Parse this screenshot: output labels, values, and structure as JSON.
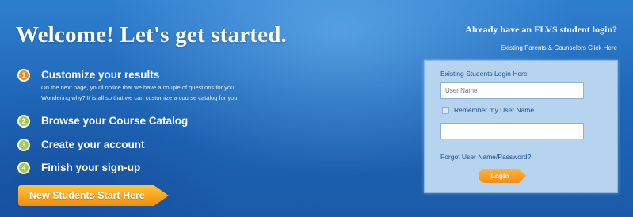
{
  "welcome": {
    "title": "Welcome! Let's get started."
  },
  "steps": [
    {
      "number": "1",
      "title": "Customize your results",
      "desc_line1": "On the next page, you'll notice that we have a couple of questions for you.",
      "desc_line2": "Wondering why? It is all so that we can customize a course catalog for you!",
      "color": "#f08a1a"
    },
    {
      "number": "2",
      "title": "Browse your Course Catalog",
      "color": "#9fcb4a"
    },
    {
      "number": "3",
      "title": "Create your account",
      "color": "#9fcb4a"
    },
    {
      "number": "4",
      "title": "Finish your sign-up",
      "color": "#9fcb4a"
    }
  ],
  "new_students_button": "New Students Start Here",
  "login": {
    "heading": "Already have an FLVS student login?",
    "parents_link": "Existing Parents & Counselors Click Here",
    "panel_title": "Existing Students Login Here",
    "username_placeholder": "User Name",
    "remember_label": "Remember my User Name",
    "password_value": "",
    "forgot_link": "Forgot User Name/Password?",
    "login_button": "Login"
  },
  "colors": {
    "banner_blue": "#1f67b8",
    "accent_orange": "#f7a21b",
    "step_green": "#9fcb4a",
    "panel_bg": "#b6d3ef",
    "panel_text": "#1d4f86"
  }
}
